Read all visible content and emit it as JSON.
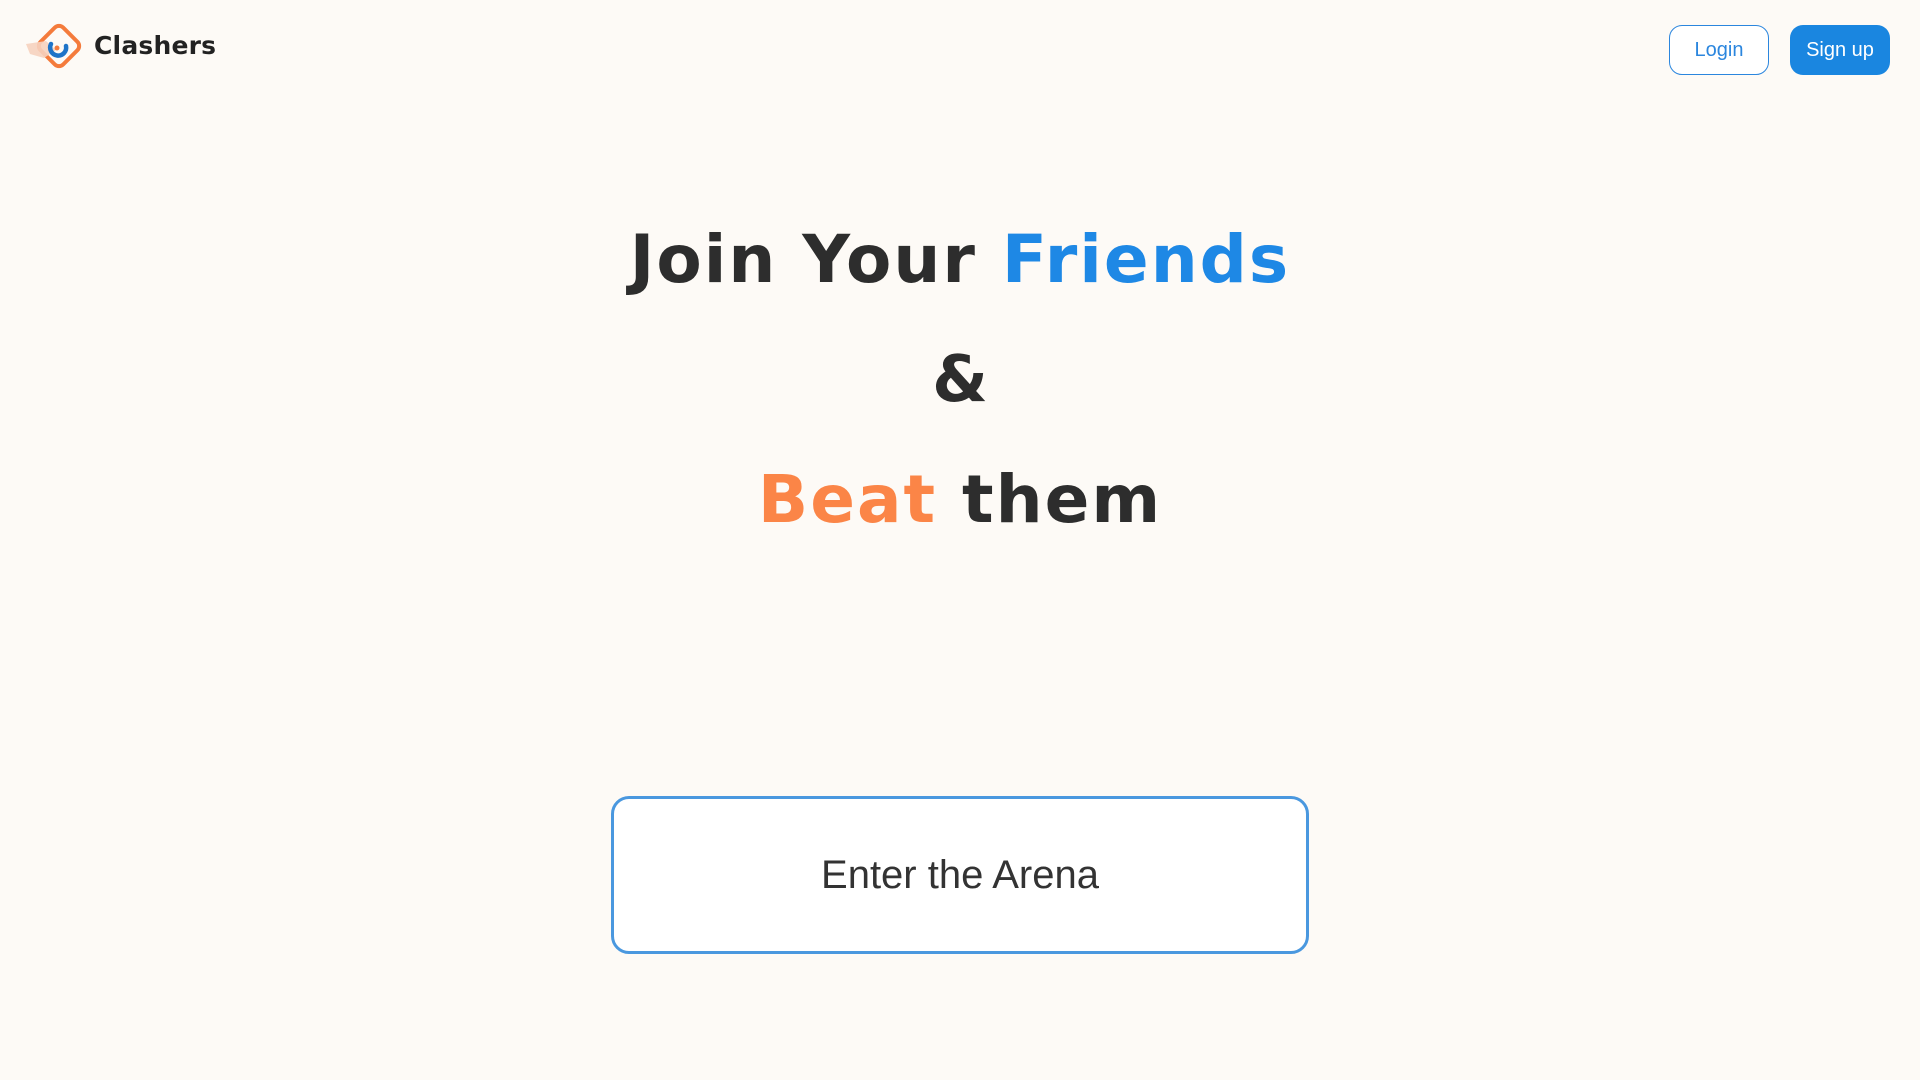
{
  "brand": {
    "name": "Clashers",
    "logo_icon": "diamond-swirl-logo-icon",
    "colors": {
      "orange": "#f47b3c",
      "blue": "#1e74c8"
    }
  },
  "nav": {
    "login_label": "Login",
    "signup_label": "Sign up"
  },
  "hero": {
    "line1_prefix": "Join Your",
    "line1_accent": "Friends",
    "line2": "&",
    "line3_accent": "Beat",
    "line3_suffix": "them"
  },
  "cta": {
    "label": "Enter the Arena"
  },
  "colors": {
    "background": "#fdfaf6",
    "primary_blue": "#1e88e5",
    "accent_orange": "#fb8547",
    "text_dark": "#2d2d2d"
  }
}
